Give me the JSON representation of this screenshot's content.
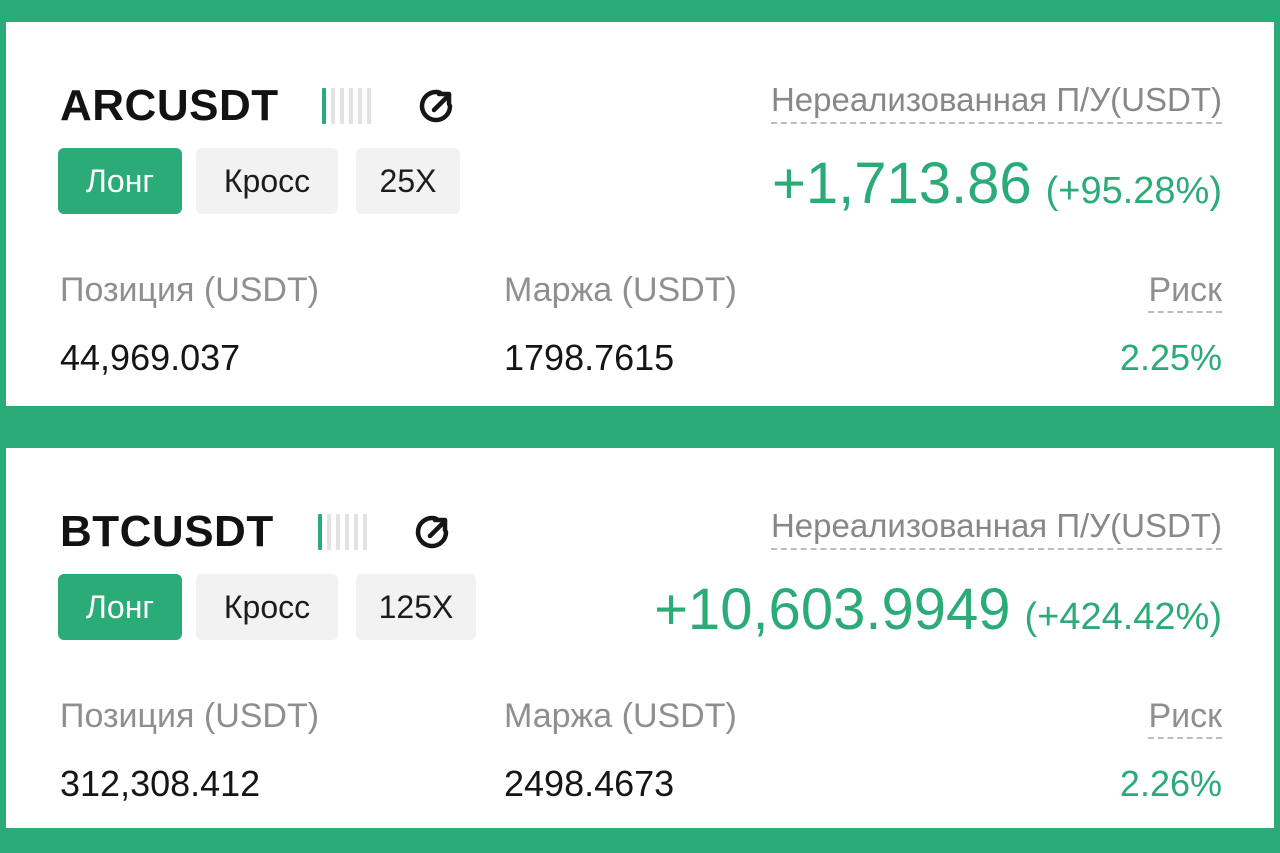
{
  "positions": [
    {
      "symbol": "ARCUSDT",
      "side": "Лонг",
      "margin_mode": "Кросс",
      "leverage": "25X",
      "pnl_label": "Нереализованная П/У(USDT)",
      "pnl_value": "+1,713.86",
      "pnl_percent": "(+95.28%)",
      "position_label": "Позиция (USDT)",
      "position_value": "44,969.037",
      "margin_label": "Маржа (USDT)",
      "margin_value": "1798.7615",
      "risk_label": "Риск",
      "risk_value": "2.25%",
      "risk_level": 1,
      "risk_level_max": 6
    },
    {
      "symbol": "BTCUSDT",
      "side": "Лонг",
      "margin_mode": "Кросс",
      "leverage": "125X",
      "pnl_label": "Нереализованная П/У(USDT)",
      "pnl_value": "+10,603.9949",
      "pnl_percent": "(+424.42%)",
      "position_label": "Позиция (USDT)",
      "position_value": "312,308.412",
      "margin_label": "Маржа (USDT)",
      "margin_value": "2498.4673",
      "risk_label": "Риск",
      "risk_value": "2.26%",
      "risk_level": 1,
      "risk_level_max": 6
    }
  ],
  "icons": {
    "share": "share-icon",
    "risk_meter": "risk-meter-icon"
  },
  "colors": {
    "accent": "#2aab77",
    "background": "#2aab77",
    "card": "#ffffff",
    "tag_bg": "#f2f2f2",
    "label": "#8f8f8f",
    "text": "#151515"
  }
}
